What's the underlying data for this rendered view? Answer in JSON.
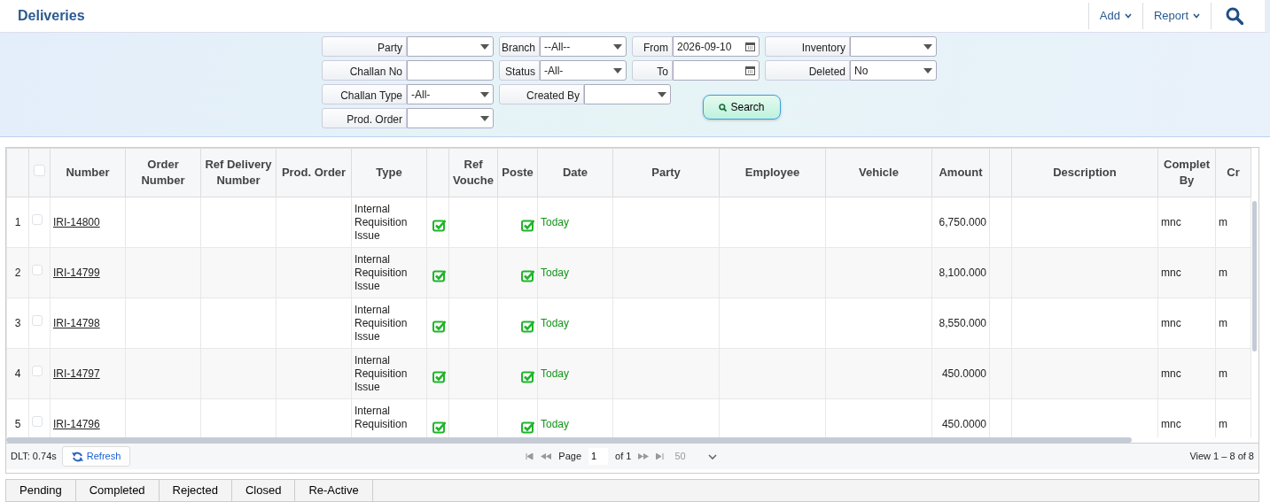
{
  "title": "Deliveries",
  "header_actions": [
    {
      "kind": "menu",
      "label": "Add"
    },
    {
      "kind": "menu",
      "label": "Report"
    },
    {
      "kind": "search"
    }
  ],
  "filters": [
    [
      {
        "label": "Party",
        "kind": "select"
      },
      {
        "label": "Challan No",
        "kind": "text"
      },
      {
        "label": "Challan Type",
        "kind": "select",
        "value": "-All-"
      },
      {
        "label": "Prod. Order",
        "kind": "select"
      }
    ],
    [
      {
        "label": "Branch",
        "kind": "select",
        "value": "--All--"
      },
      {
        "label": "Status",
        "kind": "select",
        "value": "-All-"
      },
      {
        "label": "Created By",
        "kind": "select"
      }
    ],
    [
      {
        "label": "From",
        "kind": "date",
        "value": "2026-09-10"
      },
      {
        "label": "To",
        "kind": "date"
      },
      {
        "kind": "button",
        "label": "Search"
      }
    ],
    [
      {
        "label": "Inventory",
        "kind": "select"
      },
      {
        "label": "Deleted",
        "kind": "select",
        "value": "No"
      }
    ]
  ],
  "table": {
    "all_selected": false,
    "columns": [
      {
        "label": "Number"
      },
      {
        "label": "Order Number"
      },
      {
        "label": "Ref Delivery Number"
      },
      {
        "label": "Prod. Order"
      },
      {
        "label": "Type"
      },
      {},
      {
        "label": "Ref Vouche"
      },
      {
        "label": "Poste"
      },
      {
        "label": "Date"
      },
      {
        "label": "Party"
      },
      {
        "label": "Employee"
      },
      {
        "label": "Vehicle"
      },
      {
        "label": "Amount"
      },
      {},
      {
        "label": "Description"
      },
      {
        "label": "Complet By"
      },
      {
        "label": "Cr"
      }
    ],
    "rows": [
      {
        "index": "1",
        "selected": false,
        "cells": [
          {
            "kind": "link",
            "text": "IRI-14800"
          },
          {},
          {},
          {},
          {
            "text": "Internal Requisition Issue"
          },
          {
            "kind": "tick",
            "checked": true
          },
          {},
          {
            "kind": "tick",
            "checked": true
          },
          {
            "kind": "date",
            "text": "Today"
          },
          {},
          {},
          {},
          {
            "kind": "number",
            "text": "6,750.000"
          },
          {},
          {},
          {
            "text": "mnc"
          },
          {
            "text": "m"
          }
        ]
      },
      {
        "index": "2",
        "selected": false,
        "cells": [
          {
            "kind": "link",
            "text": "IRI-14799"
          },
          {},
          {},
          {},
          {
            "text": "Internal Requisition Issue"
          },
          {
            "kind": "tick",
            "checked": true
          },
          {},
          {
            "kind": "tick",
            "checked": true
          },
          {
            "kind": "date",
            "text": "Today"
          },
          {},
          {},
          {},
          {
            "kind": "number",
            "text": "8,100.000"
          },
          {},
          {},
          {
            "text": "mnc"
          },
          {
            "text": "m"
          }
        ]
      },
      {
        "index": "3",
        "selected": false,
        "cells": [
          {
            "kind": "link",
            "text": "IRI-14798"
          },
          {},
          {},
          {},
          {
            "text": "Internal Requisition Issue"
          },
          {
            "kind": "tick",
            "checked": true
          },
          {},
          {
            "kind": "tick",
            "checked": true
          },
          {
            "kind": "date",
            "text": "Today"
          },
          {},
          {},
          {},
          {
            "kind": "number",
            "text": "8,550.000"
          },
          {},
          {},
          {
            "text": "mnc"
          },
          {
            "text": "m"
          }
        ]
      },
      {
        "index": "4",
        "selected": false,
        "cells": [
          {
            "kind": "link",
            "text": "IRI-14797"
          },
          {},
          {},
          {},
          {
            "text": "Internal Requisition Issue"
          },
          {
            "kind": "tick",
            "checked": true
          },
          {},
          {
            "kind": "tick",
            "checked": true
          },
          {
            "kind": "date",
            "text": "Today"
          },
          {},
          {},
          {},
          {
            "kind": "number",
            "text": "450.0000"
          },
          {},
          {},
          {
            "text": "mnc"
          },
          {
            "text": "m"
          }
        ]
      },
      {
        "index": "5",
        "selected": false,
        "cells": [
          {
            "kind": "link",
            "text": "IRI-14796"
          },
          {},
          {},
          {},
          {
            "text": "Internal Requisition"
          },
          {
            "kind": "tick",
            "checked": true
          },
          {},
          {
            "kind": "tick",
            "checked": true
          },
          {
            "kind": "date",
            "text": "Today"
          },
          {},
          {},
          {},
          {
            "kind": "number",
            "text": "450.0000"
          },
          {},
          {},
          {
            "text": "mnc"
          },
          {
            "text": "m"
          }
        ]
      }
    ]
  },
  "footer": {
    "timing": "DLT: 0.74s",
    "refresh": "Refresh",
    "page_label": "Page",
    "page": "1",
    "of": "of 1",
    "page_size": "50",
    "view": "View 1 – 8 of 8"
  },
  "status_tabs": [
    "Pending",
    "Completed",
    "Rejected",
    "Closed",
    "Re-Active"
  ]
}
